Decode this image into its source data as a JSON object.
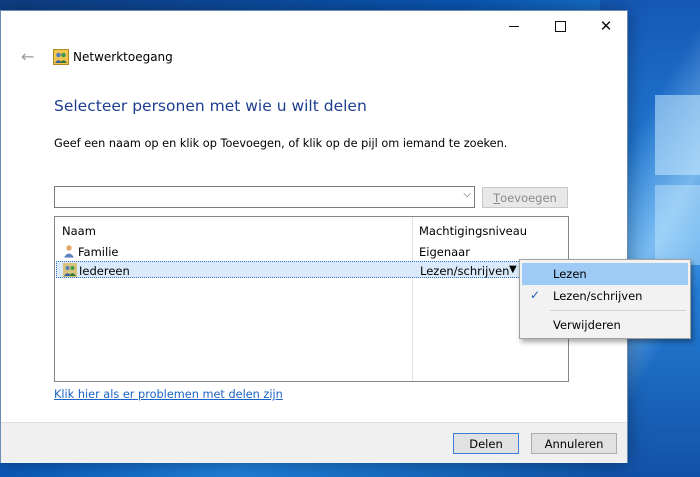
{
  "window": {
    "title": "Netwerktoegang",
    "controls": {
      "minimize": "minimize-icon",
      "maximize": "maximize-icon",
      "close": "close-icon"
    }
  },
  "page": {
    "heading": "Selecteer personen met wie u wilt delen",
    "instructions": "Geef een naam op en klik op Toevoegen, of klik op de pijl om iemand te zoeken.",
    "add_button_prefix": "T",
    "add_button_rest": "oevoegen",
    "name_input_value": ""
  },
  "list": {
    "columns": [
      "Naam",
      "Machtigingsniveau"
    ],
    "rows": [
      {
        "name": "Familie",
        "permission": "Eigenaar",
        "icon": "user-icon"
      },
      {
        "name": "Iedereen",
        "permission": "Lezen/schrijven",
        "icon": "users-group-icon",
        "selected": true
      }
    ]
  },
  "help_link": "Klik hier als er problemen met delen zijn",
  "footer": {
    "share_label": "Delen",
    "cancel_label": "Annuleren"
  },
  "dropdown": {
    "items": [
      {
        "label": "Lezen",
        "checked": false,
        "highlighted": true
      },
      {
        "label": "Lezen/schrijven",
        "checked": true
      },
      {
        "label": "Verwijderen",
        "checked": false
      }
    ]
  },
  "colors": {
    "heading": "#1e3f8f",
    "link": "#1a63c6",
    "selection": "#dbeafa",
    "menu_highlight": "#9ecbf5"
  }
}
